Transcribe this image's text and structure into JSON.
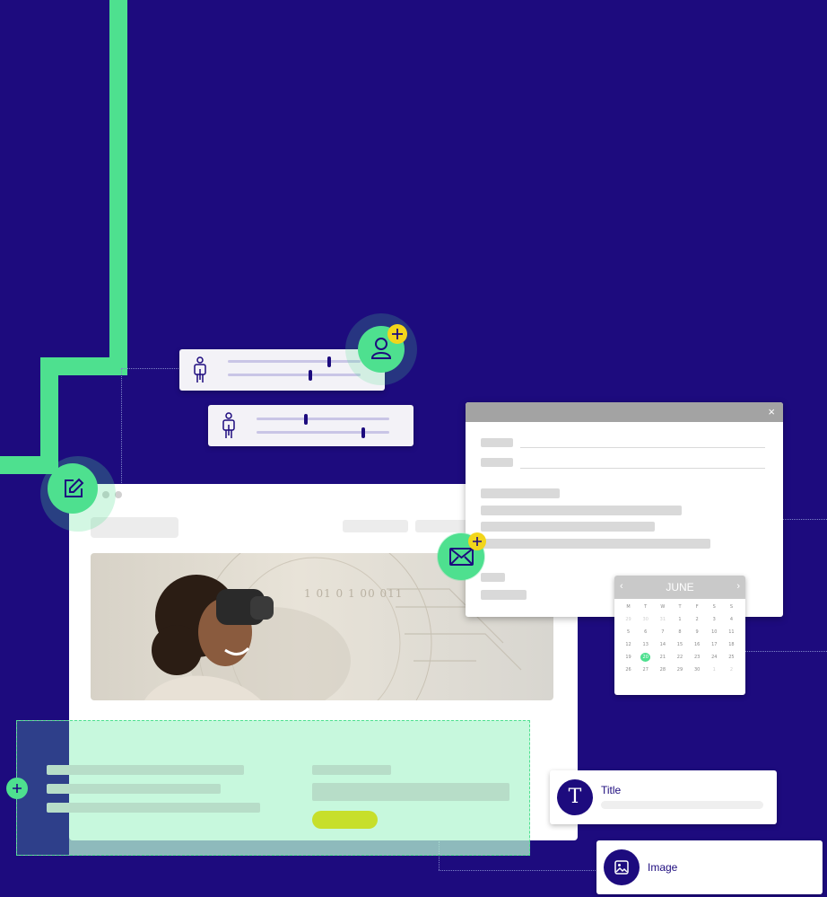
{
  "colors": {
    "background": "#1d0b7e",
    "accent_green": "#4ee08f",
    "accent_yellow": "#f2d51b",
    "button_lime": "#c7df2b"
  },
  "calendar": {
    "month": "JUNE",
    "prev_icon": "chevron-left-icon",
    "next_icon": "chevron-right-icon",
    "weekdays": [
      "M",
      "T",
      "W",
      "T",
      "F",
      "S",
      "S"
    ],
    "days": [
      "29",
      "30",
      "31",
      "1",
      "2",
      "3",
      "4",
      "5",
      "6",
      "7",
      "8",
      "9",
      "10",
      "11",
      "12",
      "13",
      "14",
      "15",
      "16",
      "17",
      "18",
      "19",
      "20",
      "21",
      "22",
      "23",
      "24",
      "25",
      "26",
      "27",
      "28",
      "29",
      "30",
      "1",
      "2"
    ],
    "selected_day": "20"
  },
  "dialog": {
    "close_label": "×"
  },
  "cards": {
    "title_card": {
      "avatar_letter": "T",
      "label": "Title"
    },
    "image_card": {
      "label": "Image",
      "icon": "image-icon"
    }
  },
  "icons": {
    "edit": "edit-icon",
    "add_user": "add-user-icon",
    "email": "email-icon",
    "add": "plus-icon",
    "person": "person-icon"
  },
  "hero_overlay_text": "1 01 0 1 00 011"
}
